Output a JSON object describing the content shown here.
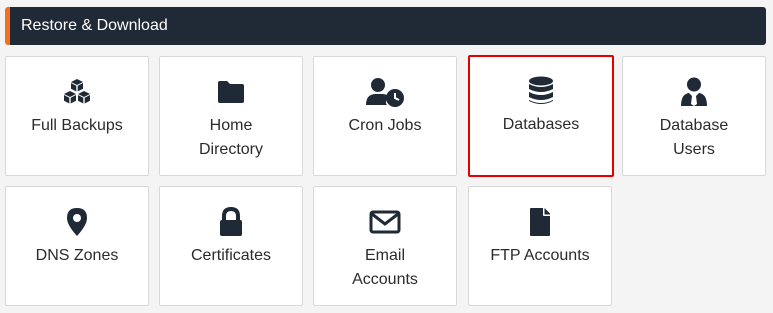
{
  "header": {
    "title": "Restore & Download"
  },
  "colors": {
    "header_bg": "#1f2a36",
    "accent": "#f36f21",
    "icon": "#1f2a36",
    "selected_border": "#e20000"
  },
  "tiles": [
    {
      "label": "Full Backups",
      "icon": "cubes-icon"
    },
    {
      "label": "Home\nDirectory",
      "icon": "folder-icon"
    },
    {
      "label": "Cron Jobs",
      "icon": "user-clock-icon"
    },
    {
      "label": "Databases",
      "icon": "database-icon",
      "selected": true
    },
    {
      "label": "Database\nUsers",
      "icon": "user-tie-icon"
    },
    {
      "label": "DNS Zones",
      "icon": "map-marker-icon"
    },
    {
      "label": "Certificates",
      "icon": "lock-icon"
    },
    {
      "label": "Email\nAccounts",
      "icon": "envelope-icon"
    },
    {
      "label": "FTP Accounts",
      "icon": "file-icon"
    }
  ]
}
